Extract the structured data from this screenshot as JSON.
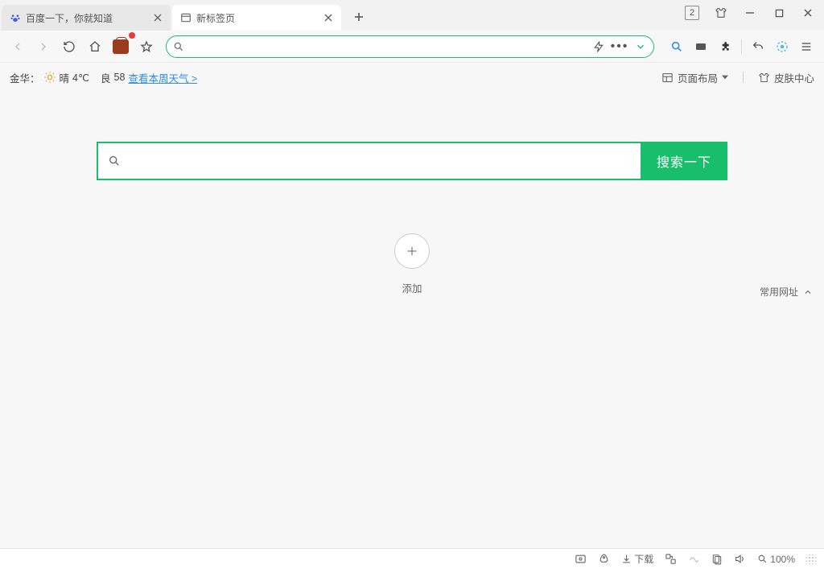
{
  "tabs": [
    {
      "title": "百度一下，你就知道",
      "active": false,
      "icon_color": "#3b5ef0"
    },
    {
      "title": "新标签页",
      "active": true
    }
  ],
  "title_badge": "2",
  "addressbar": {
    "value": "",
    "placeholder": ""
  },
  "weather": {
    "city_label": "金华：",
    "condition": "晴",
    "temp": "4℃",
    "air_label": "良",
    "air_value": "58",
    "link_text": "查看本周天气 >"
  },
  "layout": {
    "page_layout_label": "页面布局",
    "theme_center_label": "皮肤中心"
  },
  "search": {
    "placeholder": "",
    "button_label": "搜索一下"
  },
  "common_sites_label": "常用网址",
  "add_label": "添加",
  "statusbar": {
    "download_label": "下载",
    "zoom_label": "100%"
  }
}
